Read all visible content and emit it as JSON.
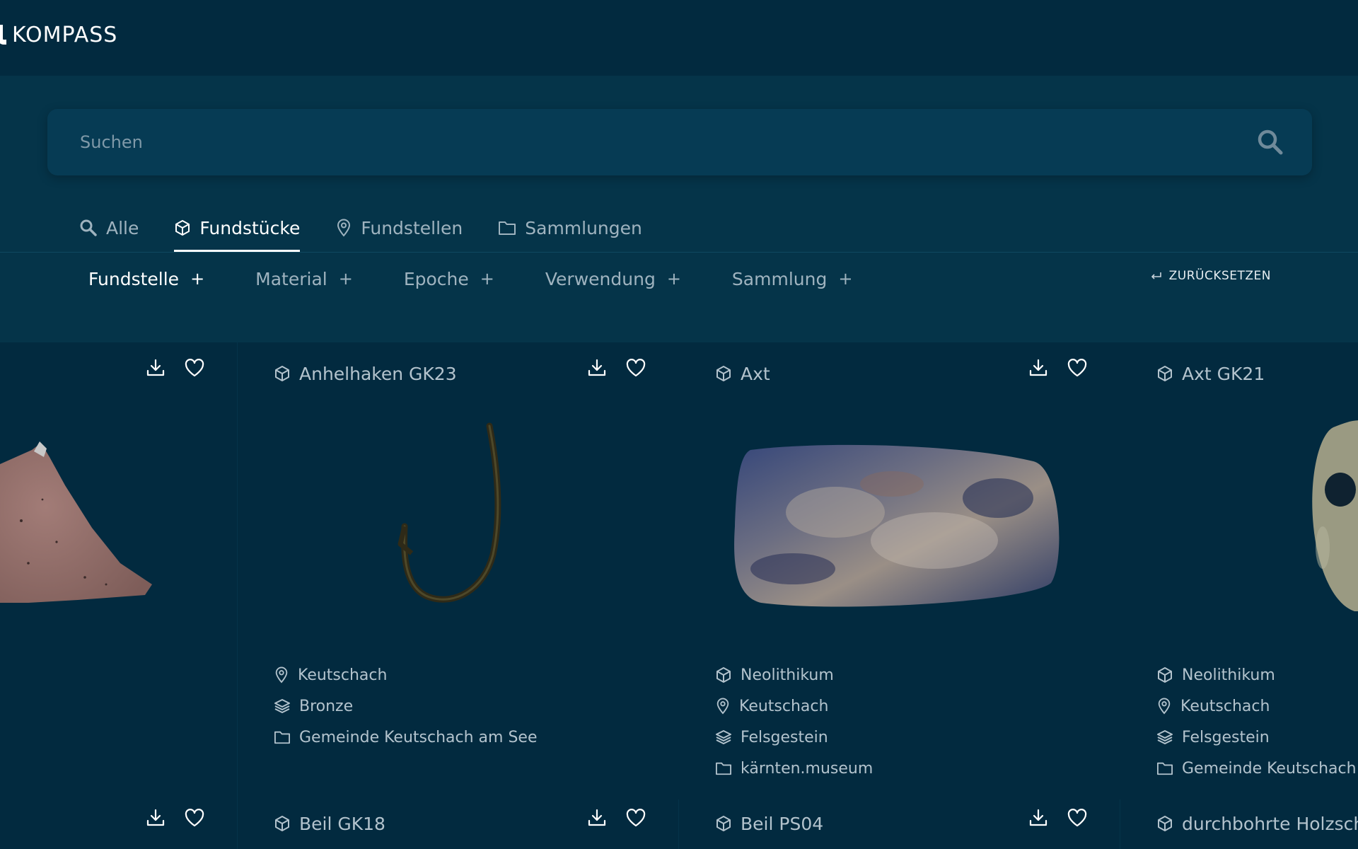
{
  "app": {
    "name": "KOMPASS"
  },
  "search": {
    "placeholder": "Suchen",
    "value": ""
  },
  "tabs": [
    {
      "label": "Alle",
      "icon": "search-icon",
      "active": false
    },
    {
      "label": "Fundstücke",
      "icon": "cube-icon",
      "active": true
    },
    {
      "label": "Fundstellen",
      "icon": "map-pin-icon",
      "active": false
    },
    {
      "label": "Sammlungen",
      "icon": "folder-icon",
      "active": false
    }
  ],
  "filters": [
    {
      "label": "Fundstelle",
      "symbol": "+",
      "active": true
    },
    {
      "label": "Material",
      "symbol": "+",
      "active": false
    },
    {
      "label": "Epoche",
      "symbol": "+",
      "active": false
    },
    {
      "label": "Verwendung",
      "symbol": "+",
      "active": false
    },
    {
      "label": "Sammlung",
      "symbol": "+",
      "active": false
    }
  ],
  "reset_label": "ZURÜCKSETZEN",
  "cards": [
    {
      "title": "",
      "image": "stone-fragment"
    },
    {
      "title": "Anhelhaken GK23",
      "image": "fish-hook",
      "meta": [
        {
          "icon": "map-pin-icon",
          "text": "Keutschach"
        },
        {
          "icon": "layers-icon",
          "text": "Bronze"
        },
        {
          "icon": "folder-icon",
          "text": "Gemeinde Keutschach am See"
        }
      ]
    },
    {
      "title": "Axt",
      "image": "stone-axe",
      "meta": [
        {
          "icon": "cube-icon",
          "text": "Neolithikum"
        },
        {
          "icon": "map-pin-icon",
          "text": "Keutschach"
        },
        {
          "icon": "layers-icon",
          "text": "Felsgestein"
        },
        {
          "icon": "folder-icon",
          "text": "kärnten.museum"
        }
      ]
    },
    {
      "title": "Axt GK21",
      "image": "perforated-axe",
      "meta": [
        {
          "icon": "cube-icon",
          "text": "Neolithikum"
        },
        {
          "icon": "map-pin-icon",
          "text": "Keutschach"
        },
        {
          "icon": "layers-icon",
          "text": "Felsgestein"
        },
        {
          "icon": "folder-icon",
          "text": "Gemeinde Keutschach"
        }
      ]
    }
  ],
  "cards_row2": [
    {
      "title": ""
    },
    {
      "title": "Beil GK18"
    },
    {
      "title": "Beil PS04"
    },
    {
      "title": "durchbohrte Holzsch"
    }
  ],
  "colors": {
    "background": "#022a3f",
    "search_band": "#053449",
    "search_box": "#063b54",
    "text_active": "#ffffff",
    "text_muted": "#9fb3bf"
  }
}
